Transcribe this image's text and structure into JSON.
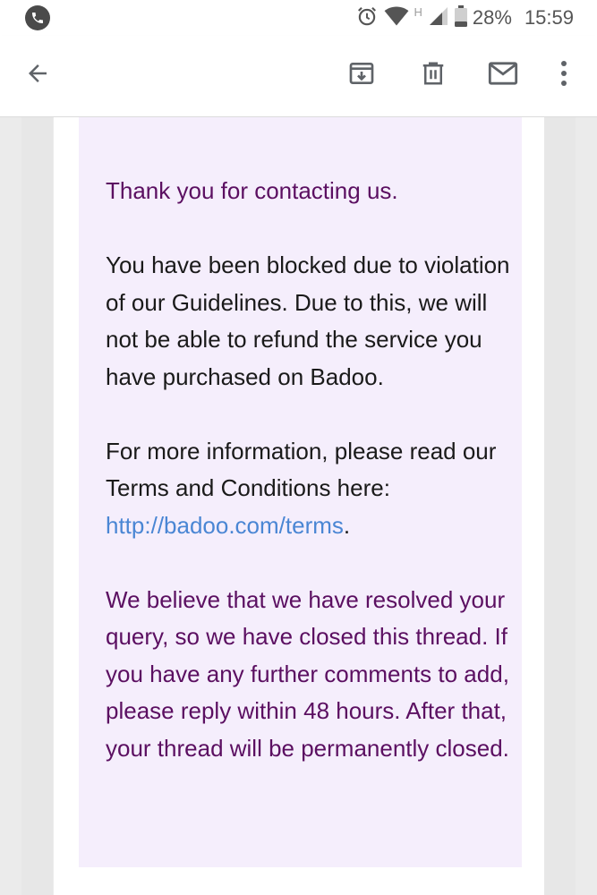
{
  "status_bar": {
    "network_letter": "H",
    "battery": "28%",
    "time": "15:59",
    "icons": [
      "phone-app-icon",
      "alarm-icon",
      "wifi-icon",
      "signal-icon",
      "battery-icon"
    ]
  },
  "app_bar": {
    "icons": [
      "back-arrow-icon",
      "archive-icon",
      "trash-icon",
      "mail-icon",
      "more-vert-icon"
    ]
  },
  "email": {
    "greeting": "Thank you for contacting us.",
    "body1": "You have been blocked due to violation of our Guidelines. Due to this, we will not be able to refund the service you have purchased on Badoo.",
    "body2_text": "For more information, please read our Terms and Conditions here: ",
    "terms_link": "http://badoo.com/terms",
    "terms_period": ".",
    "closing": "We believe that we have resolved your query, so we have closed this thread. If you have any further comments to add, please reply within 48 hours. After that, your thread will be permanently closed."
  },
  "colors": {
    "quote_background": "#f5eefc",
    "purple_text": "#5b0f61",
    "link": "#4a86d4",
    "icon_gray": "#5f6368"
  }
}
